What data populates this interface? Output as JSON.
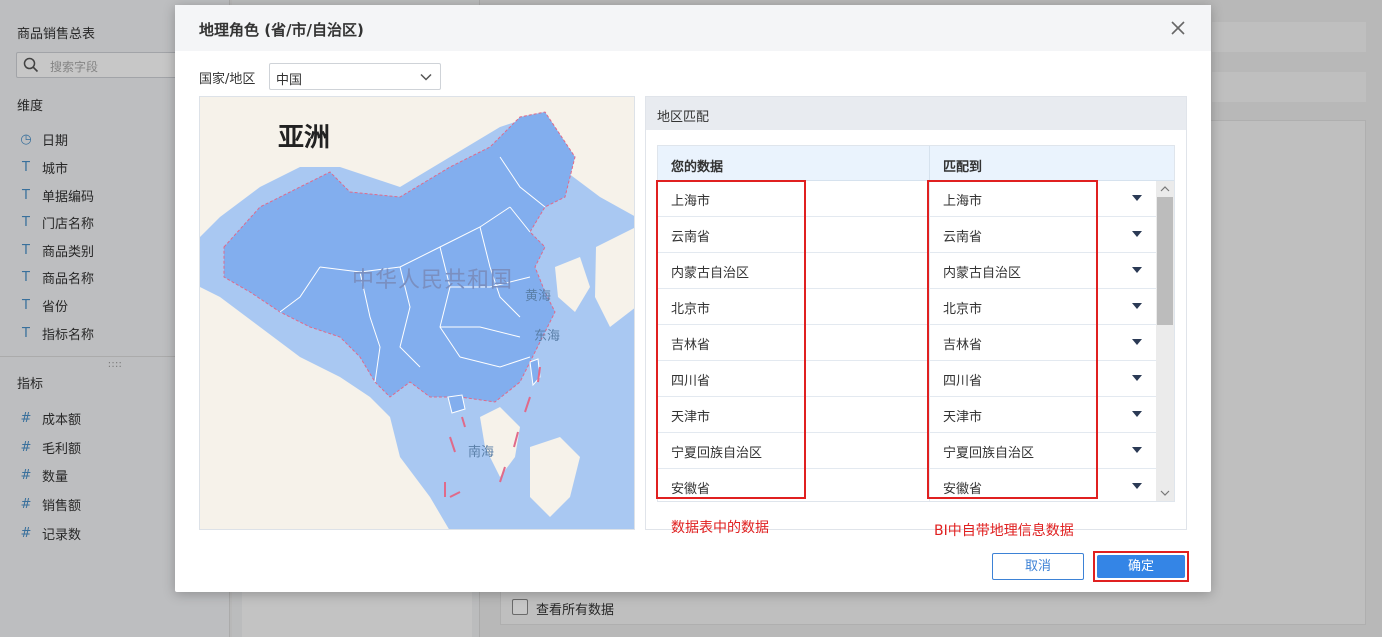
{
  "background": {
    "table_name": "商品销售总表",
    "search_placeholder": "搜索字段",
    "dimension_title": "维度",
    "dimensions": [
      {
        "glyph": "◷",
        "label": "日期"
      },
      {
        "glyph": "T",
        "label": "城市"
      },
      {
        "glyph": "T",
        "label": "单据编码"
      },
      {
        "glyph": "T",
        "label": "门店名称"
      },
      {
        "glyph": "T",
        "label": "商品类别"
      },
      {
        "glyph": "T",
        "label": "商品名称"
      },
      {
        "glyph": "T",
        "label": "省份"
      },
      {
        "glyph": "T",
        "label": "指标名称"
      }
    ],
    "measure_title": "指标",
    "measures": [
      {
        "glyph": "#",
        "label": "成本额"
      },
      {
        "glyph": "#",
        "label": "毛利额"
      },
      {
        "glyph": "#",
        "label": "数量"
      },
      {
        "glyph": "#",
        "label": "销售额"
      },
      {
        "glyph": "#",
        "label": "记录数"
      }
    ],
    "view_all_label": "查看所有数据"
  },
  "dialog": {
    "title": "地理角色 (省/市/自治区)",
    "country_label": "国家/地区",
    "country_value": "中国",
    "map": {
      "continent_label": "亚洲",
      "country_label": "中华人民共和国",
      "sea_labels": [
        "黄海",
        "东海",
        "南海"
      ]
    },
    "match": {
      "title": "地区匹配",
      "col_your_data": "您的数据",
      "col_matched": "匹配到",
      "rows": [
        {
          "data": "上海市",
          "match": "上海市"
        },
        {
          "data": "云南省",
          "match": "云南省"
        },
        {
          "data": "内蒙古自治区",
          "match": "内蒙古自治区"
        },
        {
          "data": "北京市",
          "match": "北京市"
        },
        {
          "data": "吉林省",
          "match": "吉林省"
        },
        {
          "data": "四川省",
          "match": "四川省"
        },
        {
          "data": "天津市",
          "match": "天津市"
        },
        {
          "data": "宁夏回族自治区",
          "match": "宁夏回族自治区"
        },
        {
          "data": "安徽省",
          "match": "安徽省"
        }
      ]
    },
    "annotation_left": "数据表中的数据",
    "annotation_right": "BI中自带地理信息数据",
    "cancel_label": "取消",
    "ok_label": "确定"
  },
  "colors": {
    "accent": "#3485e6",
    "annotation_red": "#e02020",
    "map_land": "#82aeee",
    "map_sea": "#a9c8f2"
  }
}
